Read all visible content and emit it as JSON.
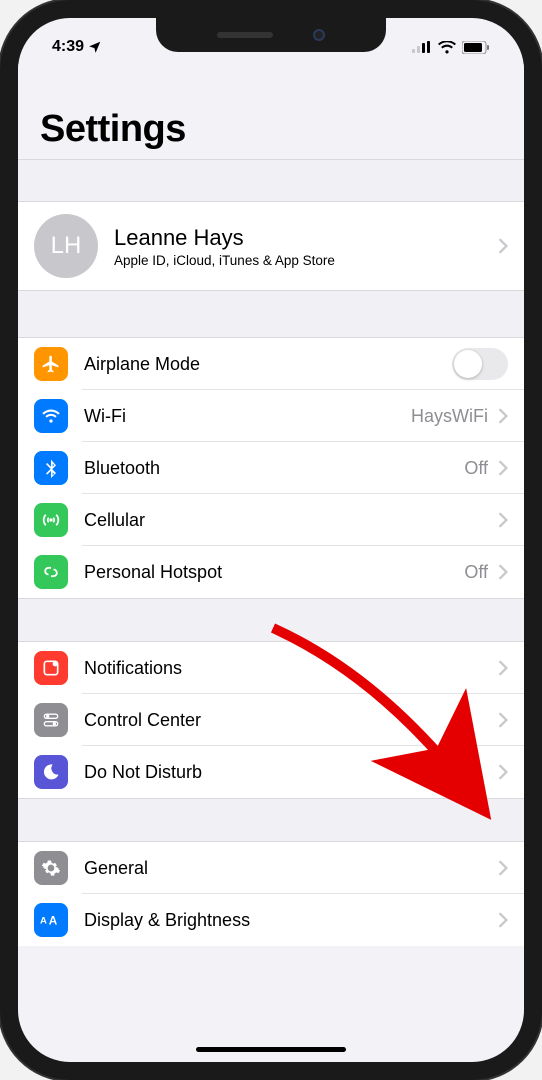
{
  "status": {
    "time": "4:39",
    "location_icon": "location-arrow"
  },
  "header": {
    "title": "Settings"
  },
  "profile": {
    "initials": "LH",
    "name": "Leanne Hays",
    "subtitle": "Apple ID, iCloud, iTunes & App Store"
  },
  "section1": [
    {
      "icon": "airplane",
      "icon_bg": "#ff9500",
      "label": "Airplane Mode",
      "accessory": "toggle",
      "toggle_on": false
    },
    {
      "icon": "wifi",
      "icon_bg": "#007aff",
      "label": "Wi-Fi",
      "value": "HaysWiFi",
      "accessory": "chevron"
    },
    {
      "icon": "bluetooth",
      "icon_bg": "#007aff",
      "label": "Bluetooth",
      "value": "Off",
      "accessory": "chevron"
    },
    {
      "icon": "cellular",
      "icon_bg": "#34c759",
      "label": "Cellular",
      "accessory": "chevron"
    },
    {
      "icon": "hotspot",
      "icon_bg": "#34c759",
      "label": "Personal Hotspot",
      "value": "Off",
      "accessory": "chevron"
    }
  ],
  "section2": [
    {
      "icon": "notifications",
      "icon_bg": "#ff3b30",
      "label": "Notifications",
      "accessory": "chevron"
    },
    {
      "icon": "control-center",
      "icon_bg": "#8e8e93",
      "label": "Control Center",
      "accessory": "chevron"
    },
    {
      "icon": "dnd",
      "icon_bg": "#5856d6",
      "label": "Do Not Disturb",
      "accessory": "chevron"
    }
  ],
  "section3": [
    {
      "icon": "general",
      "icon_bg": "#8e8e93",
      "label": "General",
      "accessory": "chevron"
    },
    {
      "icon": "display",
      "icon_bg": "#007aff",
      "label": "Display & Brightness",
      "accessory": "chevron"
    }
  ]
}
